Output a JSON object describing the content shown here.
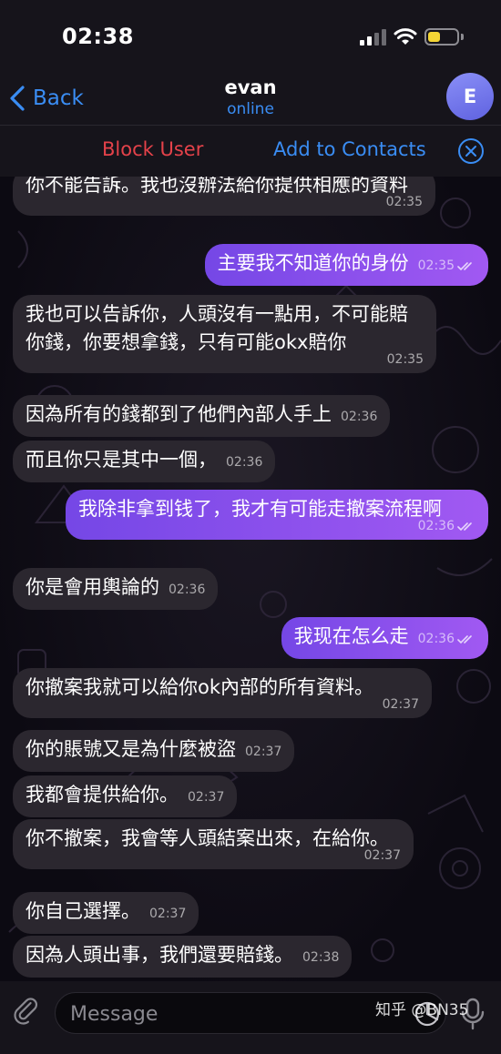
{
  "status": {
    "time": "02:38"
  },
  "header": {
    "back_label": "Back",
    "contact_name": "evan",
    "contact_status": "online",
    "avatar_initial": "E"
  },
  "actions": {
    "block_label": "Block User",
    "add_label": "Add to Contacts"
  },
  "colors": {
    "accent": "#3a8df4",
    "danger": "#e5424a",
    "incoming_bubble": "#2b272f",
    "outgoing_start": "#7547e6",
    "outgoing_end": "#a159f2"
  },
  "messages": [
    {
      "text": "你不能告訴。我也沒辦法給你提供相應的資料",
      "time": "02:35",
      "dir": "in"
    },
    {
      "text": "主要我不知道你的身份",
      "time": "02:35",
      "dir": "out"
    },
    {
      "text": "我也可以告訴你，人頭沒有一點用，不可能賠你錢，你要想拿錢，只有可能okx賠你",
      "time": "02:35",
      "dir": "in"
    },
    {
      "text": "因為所有的錢都到了他們內部人手上",
      "time": "02:36",
      "dir": "in"
    },
    {
      "text": "而且你只是其中一個，",
      "time": "02:36",
      "dir": "in"
    },
    {
      "text": "我除非拿到钱了，我才有可能走撤案流程啊",
      "time": "02:36",
      "dir": "out"
    },
    {
      "text": "你是會用輿論的",
      "time": "02:36",
      "dir": "in"
    },
    {
      "text": "我现在怎么走",
      "time": "02:36",
      "dir": "out"
    },
    {
      "text": "你撤案我就可以給你ok內部的所有資料。",
      "time": "02:37",
      "dir": "in"
    },
    {
      "text": "你的賬號又是為什麼被盜",
      "time": "02:37",
      "dir": "in"
    },
    {
      "text": "我都會提供給你。",
      "time": "02:37",
      "dir": "in"
    },
    {
      "text": "你不撤案，我會等人頭結案出來，在給你。",
      "time": "02:37",
      "dir": "in"
    },
    {
      "text": "你自己選擇。",
      "time": "02:37",
      "dir": "in"
    },
    {
      "text": "因為人頭出事，我們還要賠錢。",
      "time": "02:38",
      "dir": "in"
    }
  ],
  "composer": {
    "placeholder": "Message"
  },
  "watermark": "知乎 @BN35"
}
